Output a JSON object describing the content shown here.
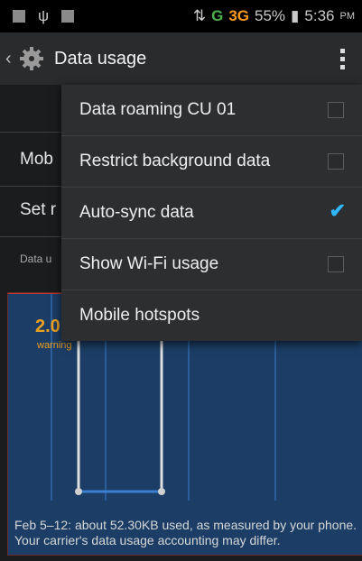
{
  "status_bar": {
    "signal_1": "G",
    "signal_2": "3G",
    "battery": "55%",
    "time": "5:36",
    "ampm": "PM"
  },
  "action_bar": {
    "title": "Data usage"
  },
  "background": {
    "row_mobile": "Mob",
    "row_set": "Set r",
    "label_data": "Data u",
    "chart_value": "2.0",
    "chart_warning": "warning",
    "footer_text": "Feb 5–12: about 52.30KB used, as measured by your phone. Your carrier's data usage accounting may differ."
  },
  "menu": {
    "items": [
      {
        "label": "Data roaming CU 01",
        "checked": false
      },
      {
        "label": "Restrict background data",
        "checked": false
      },
      {
        "label": "Auto-sync data",
        "checked": true
      },
      {
        "label": "Show Wi-Fi usage",
        "checked": false
      },
      {
        "label": "Mobile hotspots",
        "checked": null
      }
    ]
  }
}
